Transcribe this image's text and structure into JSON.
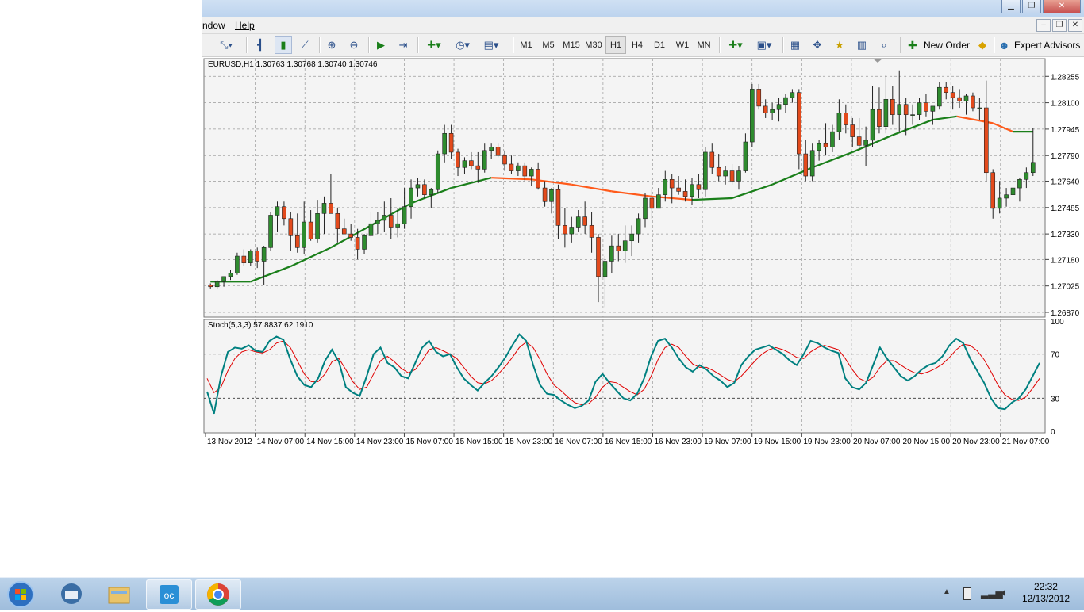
{
  "menu": {
    "window_label": "ndow",
    "help_label": "Help"
  },
  "toolbar": {
    "timeframes": [
      "M1",
      "M5",
      "M15",
      "M30",
      "H1",
      "H4",
      "D1",
      "W1",
      "MN"
    ],
    "selected_timeframe": "H1",
    "new_order_label": "New Order",
    "expert_advisors_label": "Expert Advisors"
  },
  "chart": {
    "header": "EURUSD,H1  1.30763 1.30768 1.30740 1.30746",
    "stoch_label": "Stoch(5,3,3) 57.8837 62.1910",
    "colors": {
      "up": "#2e8b2e",
      "down": "#e34a1c",
      "ma_up": "#1a7f1a",
      "ma_down": "#ff5a1a",
      "main_line": "#008080",
      "signal_line": "#e00000",
      "bg": "#f4f4f4"
    }
  },
  "chart_data": [
    {
      "type": "candlestick",
      "title": "EURUSD,H1",
      "y_ticks": [
        "1.28255",
        "1.28100",
        "1.27945",
        "1.27790",
        "1.27640",
        "1.27485",
        "1.27330",
        "1.27180",
        "1.27025",
        "1.26870"
      ],
      "ylim": [
        1.2687,
        1.2834
      ],
      "x_tick_labels": [
        "13 Nov 2012",
        "14 Nov 07:00",
        "14 Nov 15:00",
        "14 Nov 23:00",
        "15 Nov 07:00",
        "15 Nov 15:00",
        "15 Nov 23:00",
        "16 Nov 07:00",
        "16 Nov 15:00",
        "16 Nov 23:00",
        "19 Nov 07:00",
        "19 Nov 15:00",
        "19 Nov 23:00",
        "20 Nov 07:00",
        "20 Nov 15:00",
        "20 Nov 23:00",
        "21 Nov 07:00"
      ],
      "candles": [
        [
          1.2703,
          1.2704,
          1.2701,
          1.2702
        ],
        [
          1.2702,
          1.2706,
          1.2701,
          1.2705
        ],
        [
          1.2705,
          1.2708,
          1.2702,
          1.2708
        ],
        [
          1.2708,
          1.2712,
          1.2706,
          1.271
        ],
        [
          1.271,
          1.2722,
          1.2709,
          1.272
        ],
        [
          1.272,
          1.2724,
          1.2714,
          1.2716
        ],
        [
          1.2716,
          1.2724,
          1.2714,
          1.2723
        ],
        [
          1.2723,
          1.2725,
          1.2713,
          1.2717
        ],
        [
          1.2717,
          1.2726,
          1.2703,
          1.2725
        ],
        [
          1.2725,
          1.2746,
          1.2723,
          1.2744
        ],
        [
          1.2744,
          1.2752,
          1.2734,
          1.2749
        ],
        [
          1.2749,
          1.2752,
          1.2738,
          1.2742
        ],
        [
          1.2742,
          1.2746,
          1.2723,
          1.2732
        ],
        [
          1.2732,
          1.2745,
          1.2722,
          1.2725
        ],
        [
          1.2725,
          1.2752,
          1.2721,
          1.274
        ],
        [
          1.274,
          1.2747,
          1.2729,
          1.273
        ],
        [
          1.273,
          1.2753,
          1.2728,
          1.2745
        ],
        [
          1.2745,
          1.2755,
          1.2733,
          1.2751
        ],
        [
          1.2751,
          1.2768,
          1.2745,
          1.2745
        ],
        [
          1.2745,
          1.2748,
          1.2728,
          1.2736
        ],
        [
          1.2736,
          1.2742,
          1.2733,
          1.2733
        ],
        [
          1.2733,
          1.2739,
          1.2729,
          1.2731
        ],
        [
          1.2731,
          1.2736,
          1.2718,
          1.2724
        ],
        [
          1.2724,
          1.2733,
          1.2721,
          1.2732
        ],
        [
          1.2732,
          1.2746,
          1.2731,
          1.2739
        ],
        [
          1.2739,
          1.2746,
          1.2733,
          1.2741
        ],
        [
          1.2741,
          1.2752,
          1.2734,
          1.2744
        ],
        [
          1.2744,
          1.2754,
          1.273,
          1.2737
        ],
        [
          1.2737,
          1.2748,
          1.2731,
          1.2739
        ],
        [
          1.2739,
          1.276,
          1.2736,
          1.2749
        ],
        [
          1.2749,
          1.2765,
          1.2742,
          1.276
        ],
        [
          1.276,
          1.2766,
          1.2755,
          1.2762
        ],
        [
          1.2762,
          1.2765,
          1.2754,
          1.2756
        ],
        [
          1.2756,
          1.276,
          1.2748,
          1.2759
        ],
        [
          1.2759,
          1.2782,
          1.2757,
          1.278
        ],
        [
          1.278,
          1.2797,
          1.2775,
          1.2792
        ],
        [
          1.2792,
          1.2797,
          1.2777,
          1.2781
        ],
        [
          1.2781,
          1.2783,
          1.2767,
          1.2772
        ],
        [
          1.2772,
          1.2778,
          1.2768,
          1.2776
        ],
        [
          1.2776,
          1.2781,
          1.2771,
          1.2773
        ],
        [
          1.2773,
          1.2781,
          1.2763,
          1.2771
        ],
        [
          1.2771,
          1.2786,
          1.2769,
          1.2782
        ],
        [
          1.2782,
          1.2786,
          1.2777,
          1.2784
        ],
        [
          1.2784,
          1.2786,
          1.2778,
          1.2779
        ],
        [
          1.2779,
          1.2782,
          1.277,
          1.2774
        ],
        [
          1.2774,
          1.2779,
          1.2768,
          1.277
        ],
        [
          1.277,
          1.2775,
          1.2767,
          1.2773
        ],
        [
          1.2773,
          1.2775,
          1.2764,
          1.2767
        ],
        [
          1.2767,
          1.2772,
          1.2761,
          1.2771
        ],
        [
          1.2771,
          1.2775,
          1.2759,
          1.276
        ],
        [
          1.276,
          1.2764,
          1.2749,
          1.2752
        ],
        [
          1.2752,
          1.276,
          1.2745,
          1.2759
        ],
        [
          1.2759,
          1.2762,
          1.273,
          1.2738
        ],
        [
          1.2738,
          1.2748,
          1.2725,
          1.2733
        ],
        [
          1.2733,
          1.2743,
          1.2728,
          1.2737
        ],
        [
          1.2737,
          1.2747,
          1.2734,
          1.2743
        ],
        [
          1.2743,
          1.2752,
          1.2733,
          1.2738
        ],
        [
          1.2738,
          1.2746,
          1.2722,
          1.2731
        ],
        [
          1.2731,
          1.2733,
          1.2693,
          1.2708
        ],
        [
          1.2708,
          1.272,
          1.269,
          1.2717
        ],
        [
          1.2717,
          1.2732,
          1.271,
          1.2726
        ],
        [
          1.2726,
          1.2733,
          1.2717,
          1.2723
        ],
        [
          1.2723,
          1.2738,
          1.2716,
          1.2729
        ],
        [
          1.2729,
          1.2738,
          1.272,
          1.2733
        ],
        [
          1.2733,
          1.2745,
          1.2728,
          1.2742
        ],
        [
          1.2742,
          1.2757,
          1.2737,
          1.2754
        ],
        [
          1.2754,
          1.2759,
          1.2742,
          1.2748
        ],
        [
          1.2748,
          1.276,
          1.2748,
          1.2756
        ],
        [
          1.2756,
          1.277,
          1.2752,
          1.2765
        ],
        [
          1.2765,
          1.2768,
          1.2751,
          1.276
        ],
        [
          1.276,
          1.2767,
          1.2756,
          1.2758
        ],
        [
          1.2758,
          1.2765,
          1.2752,
          1.2755
        ],
        [
          1.2755,
          1.2766,
          1.275,
          1.2762
        ],
        [
          1.2762,
          1.2768,
          1.2754,
          1.2759
        ],
        [
          1.2759,
          1.2784,
          1.2755,
          1.2781
        ],
        [
          1.2781,
          1.2786,
          1.2768,
          1.2772
        ],
        [
          1.2772,
          1.278,
          1.2764,
          1.2767
        ],
        [
          1.2767,
          1.2773,
          1.2762,
          1.277
        ],
        [
          1.277,
          1.2774,
          1.2762,
          1.2764
        ],
        [
          1.2764,
          1.2773,
          1.2759,
          1.277
        ],
        [
          1.277,
          1.2792,
          1.2769,
          1.2787
        ],
        [
          1.2787,
          1.2821,
          1.2784,
          1.2818
        ],
        [
          1.2818,
          1.2821,
          1.2806,
          1.2808
        ],
        [
          1.2808,
          1.2812,
          1.2801,
          1.2804
        ],
        [
          1.2804,
          1.281,
          1.28,
          1.2806
        ],
        [
          1.2806,
          1.2813,
          1.2799,
          1.2809
        ],
        [
          1.2809,
          1.2815,
          1.2804,
          1.2813
        ],
        [
          1.2813,
          1.2818,
          1.281,
          1.2816
        ],
        [
          1.2816,
          1.2818,
          1.2771,
          1.278
        ],
        [
          1.278,
          1.2788,
          1.2764,
          1.2767
        ],
        [
          1.2767,
          1.2786,
          1.2764,
          1.2782
        ],
        [
          1.2782,
          1.2788,
          1.2776,
          1.2786
        ],
        [
          1.2786,
          1.2798,
          1.2779,
          1.2784
        ],
        [
          1.2784,
          1.2797,
          1.2781,
          1.2793
        ],
        [
          1.2793,
          1.2812,
          1.2788,
          1.2804
        ],
        [
          1.2804,
          1.2809,
          1.2792,
          1.2797
        ],
        [
          1.2797,
          1.2801,
          1.2784,
          1.279
        ],
        [
          1.279,
          1.2801,
          1.2782,
          1.2785
        ],
        [
          1.2785,
          1.2796,
          1.2773,
          1.2788
        ],
        [
          1.2788,
          1.282,
          1.2784,
          1.2806
        ],
        [
          1.2806,
          1.2819,
          1.2792,
          1.2796
        ],
        [
          1.2796,
          1.2826,
          1.2792,
          1.2812
        ],
        [
          1.2812,
          1.282,
          1.2797,
          1.2803
        ],
        [
          1.2803,
          1.2829,
          1.2793,
          1.2809
        ],
        [
          1.2809,
          1.2813,
          1.2791,
          1.2803
        ],
        [
          1.2803,
          1.2809,
          1.2797,
          1.2803
        ],
        [
          1.2803,
          1.2813,
          1.28,
          1.281
        ],
        [
          1.281,
          1.2815,
          1.2802,
          1.2805
        ],
        [
          1.2805,
          1.2808,
          1.2797,
          1.2808
        ],
        [
          1.2808,
          1.2822,
          1.2806,
          1.2819
        ],
        [
          1.2819,
          1.2822,
          1.2812,
          1.2816
        ],
        [
          1.2816,
          1.282,
          1.2806,
          1.2813
        ],
        [
          1.2813,
          1.2818,
          1.2807,
          1.2811
        ],
        [
          1.2811,
          1.2815,
          1.2803,
          1.2814
        ],
        [
          1.2814,
          1.2816,
          1.2805,
          1.2807
        ],
        [
          1.2807,
          1.2813,
          1.28,
          1.2807
        ],
        [
          1.2807,
          1.2823,
          1.2764,
          1.2769
        ],
        [
          1.2769,
          1.2771,
          1.2742,
          1.2748
        ],
        [
          1.2748,
          1.2764,
          1.2745,
          1.2754
        ],
        [
          1.2754,
          1.276,
          1.2749,
          1.2756
        ],
        [
          1.2756,
          1.2763,
          1.2746,
          1.276
        ],
        [
          1.276,
          1.2766,
          1.2752,
          1.2765
        ],
        [
          1.2765,
          1.2772,
          1.276,
          1.2769
        ],
        [
          1.2769,
          1.2795,
          1.2767,
          1.2775
        ]
      ],
      "moving_average": [
        [
          0,
          1.2705
        ],
        [
          10,
          1.2705
        ],
        [
          20,
          1.2714
        ],
        [
          30,
          1.2725
        ],
        [
          40,
          1.2738
        ],
        [
          50,
          1.2751
        ],
        [
          60,
          1.276
        ],
        [
          70,
          1.2766
        ],
        [
          80,
          1.2765
        ],
        [
          90,
          1.2762
        ],
        [
          100,
          1.2758
        ],
        [
          110,
          1.2755
        ],
        [
          120,
          1.2753
        ],
        [
          130,
          1.2754
        ],
        [
          140,
          1.2762
        ],
        [
          150,
          1.2772
        ],
        [
          160,
          1.2781
        ],
        [
          170,
          1.2791
        ],
        [
          180,
          1.28
        ],
        [
          186,
          1.2802
        ],
        [
          195,
          1.2798
        ],
        [
          200,
          1.2793
        ],
        [
          205,
          1.2793
        ]
      ]
    },
    {
      "type": "line",
      "title": "Stoch(5,3,3) 57.8837 62.1910",
      "y_ticks": [
        "100",
        "70",
        "30",
        "0"
      ],
      "ylim": [
        0,
        100
      ],
      "levels": [
        70,
        30
      ],
      "series": [
        {
          "values": [
            36,
            16,
            50,
            72,
            76,
            75,
            78,
            73,
            72,
            82,
            86,
            83,
            65,
            50,
            42,
            40,
            48,
            64,
            74,
            63,
            40,
            35,
            32,
            50,
            70,
            76,
            62,
            58,
            50,
            48,
            62,
            76,
            82,
            72,
            68,
            70,
            58,
            48,
            42,
            37,
            44,
            50,
            58,
            67,
            78,
            88,
            82,
            60,
            42,
            34,
            33,
            28,
            24,
            21,
            23,
            28,
            45,
            52,
            44,
            37,
            30,
            28,
            34,
            48,
            68,
            82,
            84,
            76,
            66,
            58,
            54,
            60,
            56,
            50,
            46,
            40,
            44,
            60,
            68,
            74,
            76,
            78,
            74,
            70,
            64,
            60,
            70,
            82,
            80,
            76,
            73,
            71,
            48,
            40,
            38,
            44,
            60,
            76,
            66,
            58,
            50,
            46,
            50,
            56,
            60,
            62,
            68,
            78,
            84,
            80,
            66,
            55,
            44,
            30,
            21,
            20,
            26,
            30,
            38,
            50,
            62
          ]
        },
        {
          "values": [
            48,
            35,
            40,
            55,
            66,
            72,
            74,
            72,
            71,
            74,
            80,
            82,
            76,
            64,
            52,
            45,
            45,
            52,
            63,
            66,
            56,
            45,
            38,
            40,
            52,
            64,
            68,
            63,
            57,
            53,
            56,
            64,
            74,
            76,
            73,
            70,
            66,
            58,
            50,
            44,
            43,
            46,
            52,
            59,
            67,
            76,
            81,
            76,
            65,
            52,
            42,
            37,
            31,
            26,
            24,
            25,
            31,
            40,
            45,
            44,
            40,
            36,
            33,
            38,
            50,
            65,
            76,
            79,
            76,
            68,
            61,
            58,
            58,
            55,
            51,
            47,
            45,
            50,
            57,
            64,
            70,
            74,
            76,
            74,
            71,
            67,
            66,
            72,
            76,
            78,
            76,
            74,
            66,
            56,
            48,
            45,
            49,
            58,
            64,
            64,
            60,
            56,
            53,
            52,
            54,
            57,
            61,
            67,
            74,
            79,
            78,
            73,
            65,
            54,
            42,
            33,
            29,
            28,
            31,
            39,
            48
          ]
        }
      ]
    }
  ],
  "taskbar": {
    "time": "22:32",
    "date": "12/13/2012"
  }
}
